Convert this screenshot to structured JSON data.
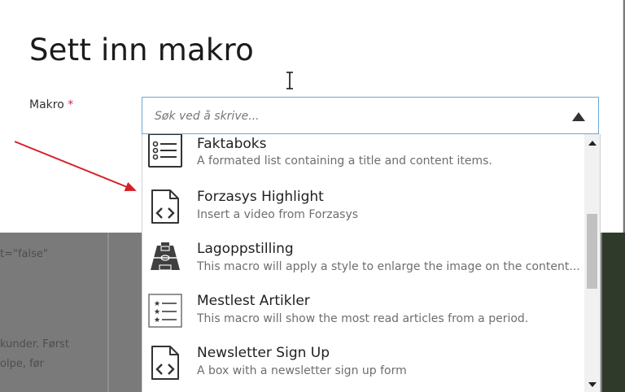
{
  "dialog": {
    "title": "Sett inn makro",
    "field_label": "Makro",
    "required_marker": "*"
  },
  "select": {
    "placeholder": "Søk ved å skrive..."
  },
  "options": [
    {
      "title": "Faktaboks",
      "description": "A formated list containing a title and content items.",
      "icon": "list-icon"
    },
    {
      "title": "Forzasys Highlight",
      "description": "Insert a video from Forzasys",
      "icon": "code-file-icon"
    },
    {
      "title": "Lagoppstilling",
      "description": "This macro will apply a style to enlarge the image on the content...",
      "icon": "football-field-icon"
    },
    {
      "title": "Mestlest Artikler",
      "description": "This macro will show the most read articles from a period.",
      "icon": "star-list-icon"
    },
    {
      "title": "Newsletter Sign Up",
      "description": "A box with a newsletter sign up form",
      "icon": "code-file-icon"
    }
  ],
  "background": {
    "text_1": "t=\"false\"",
    "text_2": "kunder. Først",
    "text_3": "olpe, før"
  },
  "colors": {
    "accent_border": "#6aa8d6",
    "required": "#d42054",
    "annotation_arrow": "#d61f26"
  }
}
